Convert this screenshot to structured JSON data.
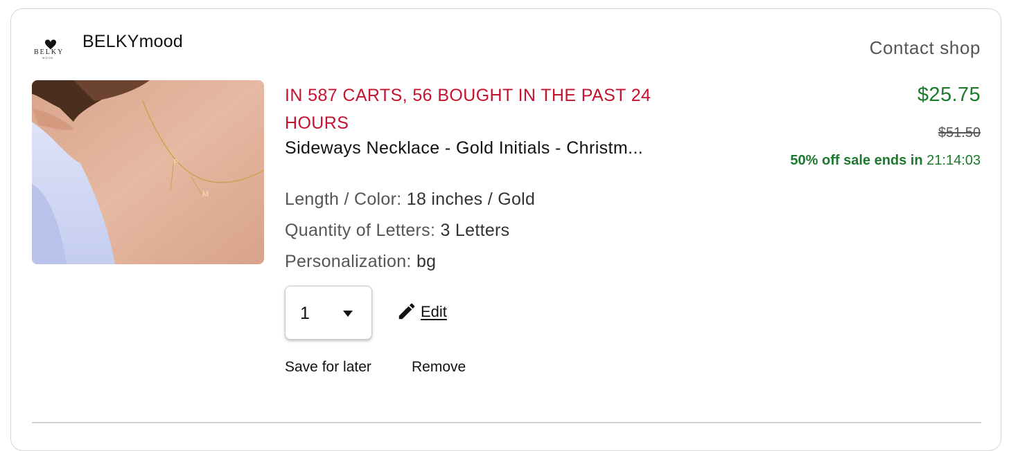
{
  "shop": {
    "logo_text": "BELKY",
    "logo_subtext": "MOOD",
    "name": "BELKYmood",
    "contact_label": "Contact shop"
  },
  "item": {
    "urgency": "IN 587 CARTS, 56 BOUGHT IN THE PAST 24 HOURS",
    "title": "Sideways Necklace - Gold Initials - Christm...",
    "image_letters": [
      "P",
      "M"
    ],
    "variations": [
      {
        "label": "Length / Color:",
        "value": "18 inches / Gold"
      },
      {
        "label": "Quantity of Letters:",
        "value": "3 Letters"
      },
      {
        "label": "Personalization:",
        "value": "bg"
      }
    ],
    "quantity": "1",
    "edit_label": "Edit",
    "save_later_label": "Save for later",
    "remove_label": "Remove"
  },
  "pricing": {
    "price": "$25.75",
    "original_price": "$51.50",
    "sale_label": "50% off sale ends in",
    "countdown": "21:14:03"
  },
  "colors": {
    "urgency": "#c4122f",
    "price": "#1b7a2b",
    "text": "#111111",
    "muted": "#555555"
  },
  "icons": {
    "edit": "pencil-icon",
    "quantity": "caret-down-icon",
    "logo": "heart-icon"
  }
}
